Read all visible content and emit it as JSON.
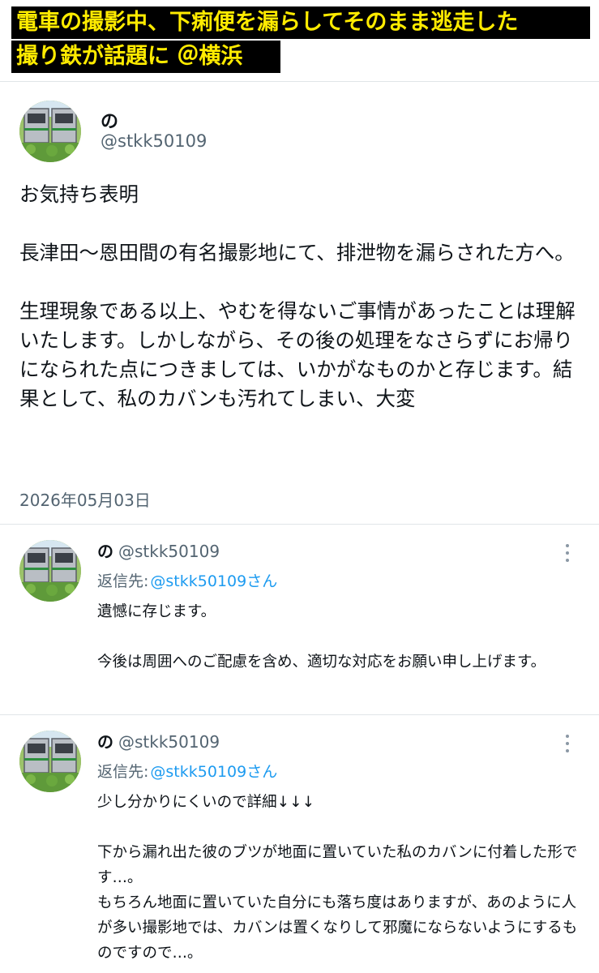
{
  "headline": {
    "line1": "電車の撮影中、下痢便を漏らしてそのまま逃走した",
    "line2": "撮り鉄が話題に ＠横浜"
  },
  "main_tweet": {
    "avatar_icon": "train-photo-avatar",
    "name": "の",
    "handle": "@stkk50109",
    "text": "お気持ち表明\n\n長津田〜恩田間の有名撮影地にて、排泄物を漏らされた方へ。\n\n生理現象である以上、やむを得ないご事情があったことは理解いたします。しかしながら、その後の処理をなさらずにお帰りになられた点につきましては、いかがなものかと存じます。結果として、私のカバンも汚れてしまい、大変",
    "date": "2026年05月03日"
  },
  "replies": [
    {
      "avatar_icon": "train-photo-avatar",
      "name": "の",
      "handle": "@stkk50109",
      "reply_to_label": "返信先:",
      "reply_to_handle": "@stkk50109さん",
      "text": "遺憾に存じます。\n\n今後は周囲へのご配慮を含め、適切な対応をお願い申し上げます。",
      "more_icon": "more-vertical-icon"
    },
    {
      "avatar_icon": "train-photo-avatar",
      "name": "の",
      "handle": "@stkk50109",
      "reply_to_label": "返信先:",
      "reply_to_handle": "@stkk50109さん",
      "text": "少し分かりにくいので詳細↓↓↓\n\n下から漏れ出た彼のブツが地面に置いていた私のカバンに付着した形です…。\nもちろん地面に置いていた自分にも落ち度はありますが、あのように人が多い撮影地では、カバンは置くなりして邪魔にならないようにするものですので…。",
      "more_icon": "more-vertical-icon"
    }
  ],
  "colors": {
    "headline_bg": "#000000",
    "headline_text": "#ffeb00",
    "link": "#1d9bf0",
    "secondary_text": "#536471"
  }
}
